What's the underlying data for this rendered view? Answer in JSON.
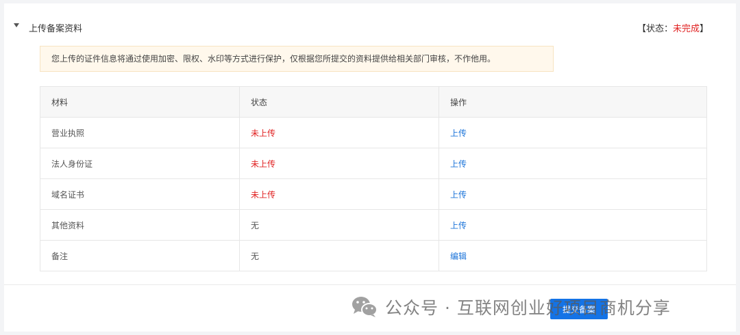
{
  "section": {
    "title": "上传备案资料",
    "status_prefix": "【状态：",
    "status_value": "未完成",
    "status_suffix": "】"
  },
  "notice": {
    "text": "您上传的证件信息将通过使用加密、限权、水印等方式进行保护，仅根据您所提交的资料提供给相关部门审核，不作他用。"
  },
  "table": {
    "headers": [
      "材料",
      "状态",
      "操作"
    ],
    "rows": [
      {
        "material": "营业执照",
        "status": "未上传",
        "action": "上传"
      },
      {
        "material": "法人身份证",
        "status": "未上传",
        "action": "上传"
      },
      {
        "material": "域名证书",
        "status": "未上传",
        "action": "上传"
      },
      {
        "material": "其他资料",
        "status": "无",
        "action": "上传"
      },
      {
        "material": "备注",
        "status": "无",
        "action": "编辑"
      }
    ]
  },
  "footer": {
    "submit_label": "提交备案"
  },
  "watermark": {
    "text": "公众号 · 互联网创业好项目商机分享",
    "icon": "wechat-icon"
  },
  "colors": {
    "accent": "#1473e6",
    "link": "#1a73d9",
    "warning": "#e02020",
    "notice_bg": "#fff8ec"
  }
}
